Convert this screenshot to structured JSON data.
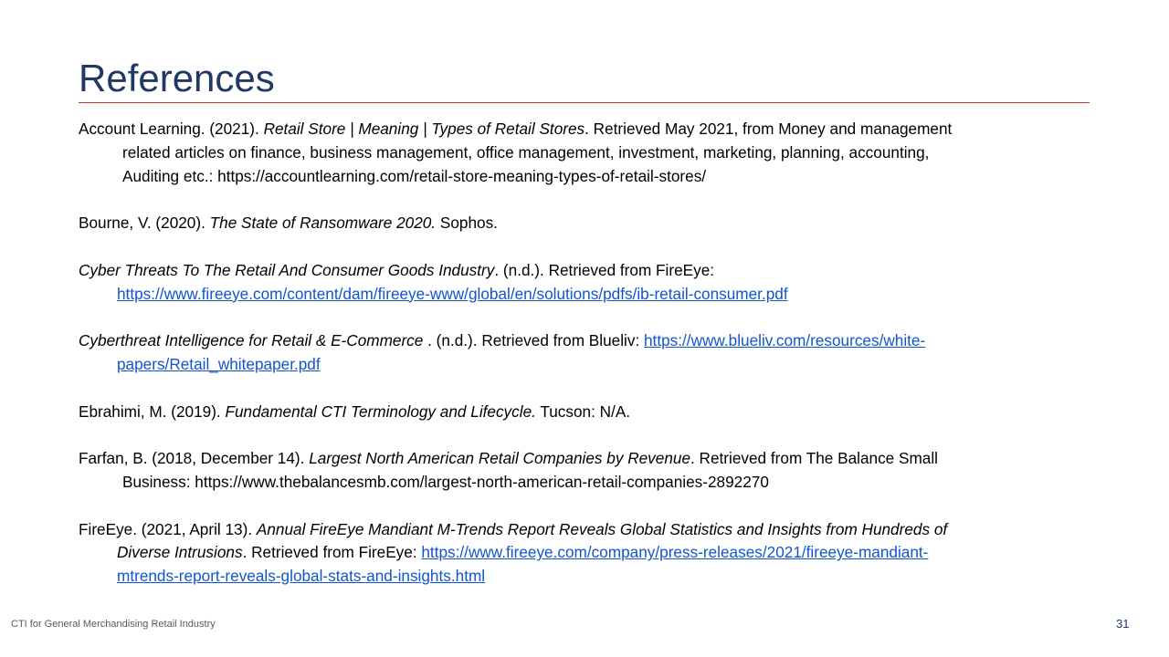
{
  "title": "References",
  "refs": {
    "r1": {
      "l1a": "Account Learning. (2021). ",
      "l1b": "Retail Store | Meaning | Types of Retail Stores",
      "l1c": ". Retrieved May 2021, from Money and management",
      "l2": "related articles on finance, business management, office management, investment, marketing, planning, accounting,",
      "l3": "Auditing etc.: https://accountlearning.com/retail-store-meaning-types-of-retail-stores/"
    },
    "r2": {
      "a": "Bourne, V. (2020). ",
      "b": "The State of Ransomware 2020.",
      "c": " Sophos."
    },
    "r3": {
      "a": "Cyber Threats To The Retail And Consumer Goods Industry",
      "b": ". (n.d.). Retrieved from FireEye:",
      "link": "https://www.fireeye.com/content/dam/fireeye-www/global/en/solutions/pdfs/ib-retail-consumer.pdf"
    },
    "r4": {
      "a": "Cyberthreat Intelligence for Retail & E-Commerce ",
      "b": ". (n.d.). Retrieved from Blueliv: ",
      "link1": "https://www.blueliv.com/resources/white-",
      "link2": "papers/Retail_whitepaper.pdf"
    },
    "r5": {
      "a": "Ebrahimi, M. (2019). ",
      "b": "Fundamental CTI Terminology and Lifecycle.",
      "c": " Tucson: N/A."
    },
    "r6": {
      "a": "Farfan, B. (2018, December 14). ",
      "b": "Largest North American Retail Companies by Revenue",
      "c": ". Retrieved from The Balance Small",
      "l2": "Business: https://www.thebalancesmb.com/largest-north-american-retail-companies-2892270"
    },
    "r7": {
      "a": "FireEye. (2021, April 13). ",
      "b": "Annual FireEye Mandiant M-Trends Report Reveals Global Statistics and Insights from Hundreds of",
      "c": "Diverse Intrusions",
      "d": ". Retrieved from FireEye: ",
      "link1": "https://www.fireeye.com/company/press-releases/2021/fireeye-mandiant-",
      "link2": "mtrends-report-reveals-global-stats-and-insights.html"
    }
  },
  "footer": "CTI for  General Merchandising Retail Industry",
  "page_number": "31"
}
